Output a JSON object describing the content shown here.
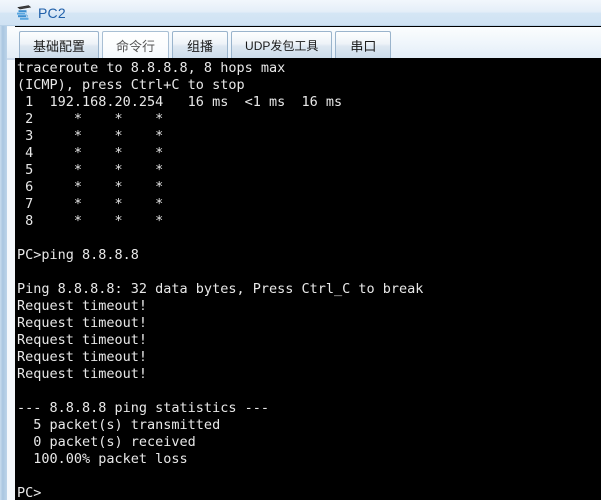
{
  "window": {
    "title": "PC2",
    "icon": "pc-device-icon"
  },
  "tabs": [
    {
      "id": "basic-config",
      "label": "基础配置",
      "active": false
    },
    {
      "id": "command-line",
      "label": "命令行",
      "active": true
    },
    {
      "id": "multicast",
      "label": "组播",
      "active": false
    },
    {
      "id": "udp-packet-tool",
      "label": "UDP发包工具",
      "active": false
    },
    {
      "id": "serial-port",
      "label": "串口",
      "active": false
    }
  ],
  "terminal": {
    "lines": [
      "traceroute to 8.8.8.8, 8 hops max",
      "(ICMP), press Ctrl+C to stop",
      " 1  192.168.20.254   16 ms  <1 ms  16 ms",
      " 2     *    *    *",
      " 3     *    *    *",
      " 4     *    *    *",
      " 5     *    *    *",
      " 6     *    *    *",
      " 7     *    *    *",
      " 8     *    *    *",
      "",
      "PC>ping 8.8.8.8",
      "",
      "Ping 8.8.8.8: 32 data bytes, Press Ctrl_C to break",
      "Request timeout!",
      "Request timeout!",
      "Request timeout!",
      "Request timeout!",
      "Request timeout!",
      "",
      "--- 8.8.8.8 ping statistics ---",
      "  5 packet(s) transmitted",
      "  0 packet(s) received",
      "  100.00% packet loss",
      "",
      "PC>"
    ]
  },
  "colors": {
    "terminal_bg": "#000000",
    "terminal_fg": "#e8e8e8",
    "title_text": "#1f5fa9",
    "accent": "#a9c6e0"
  }
}
